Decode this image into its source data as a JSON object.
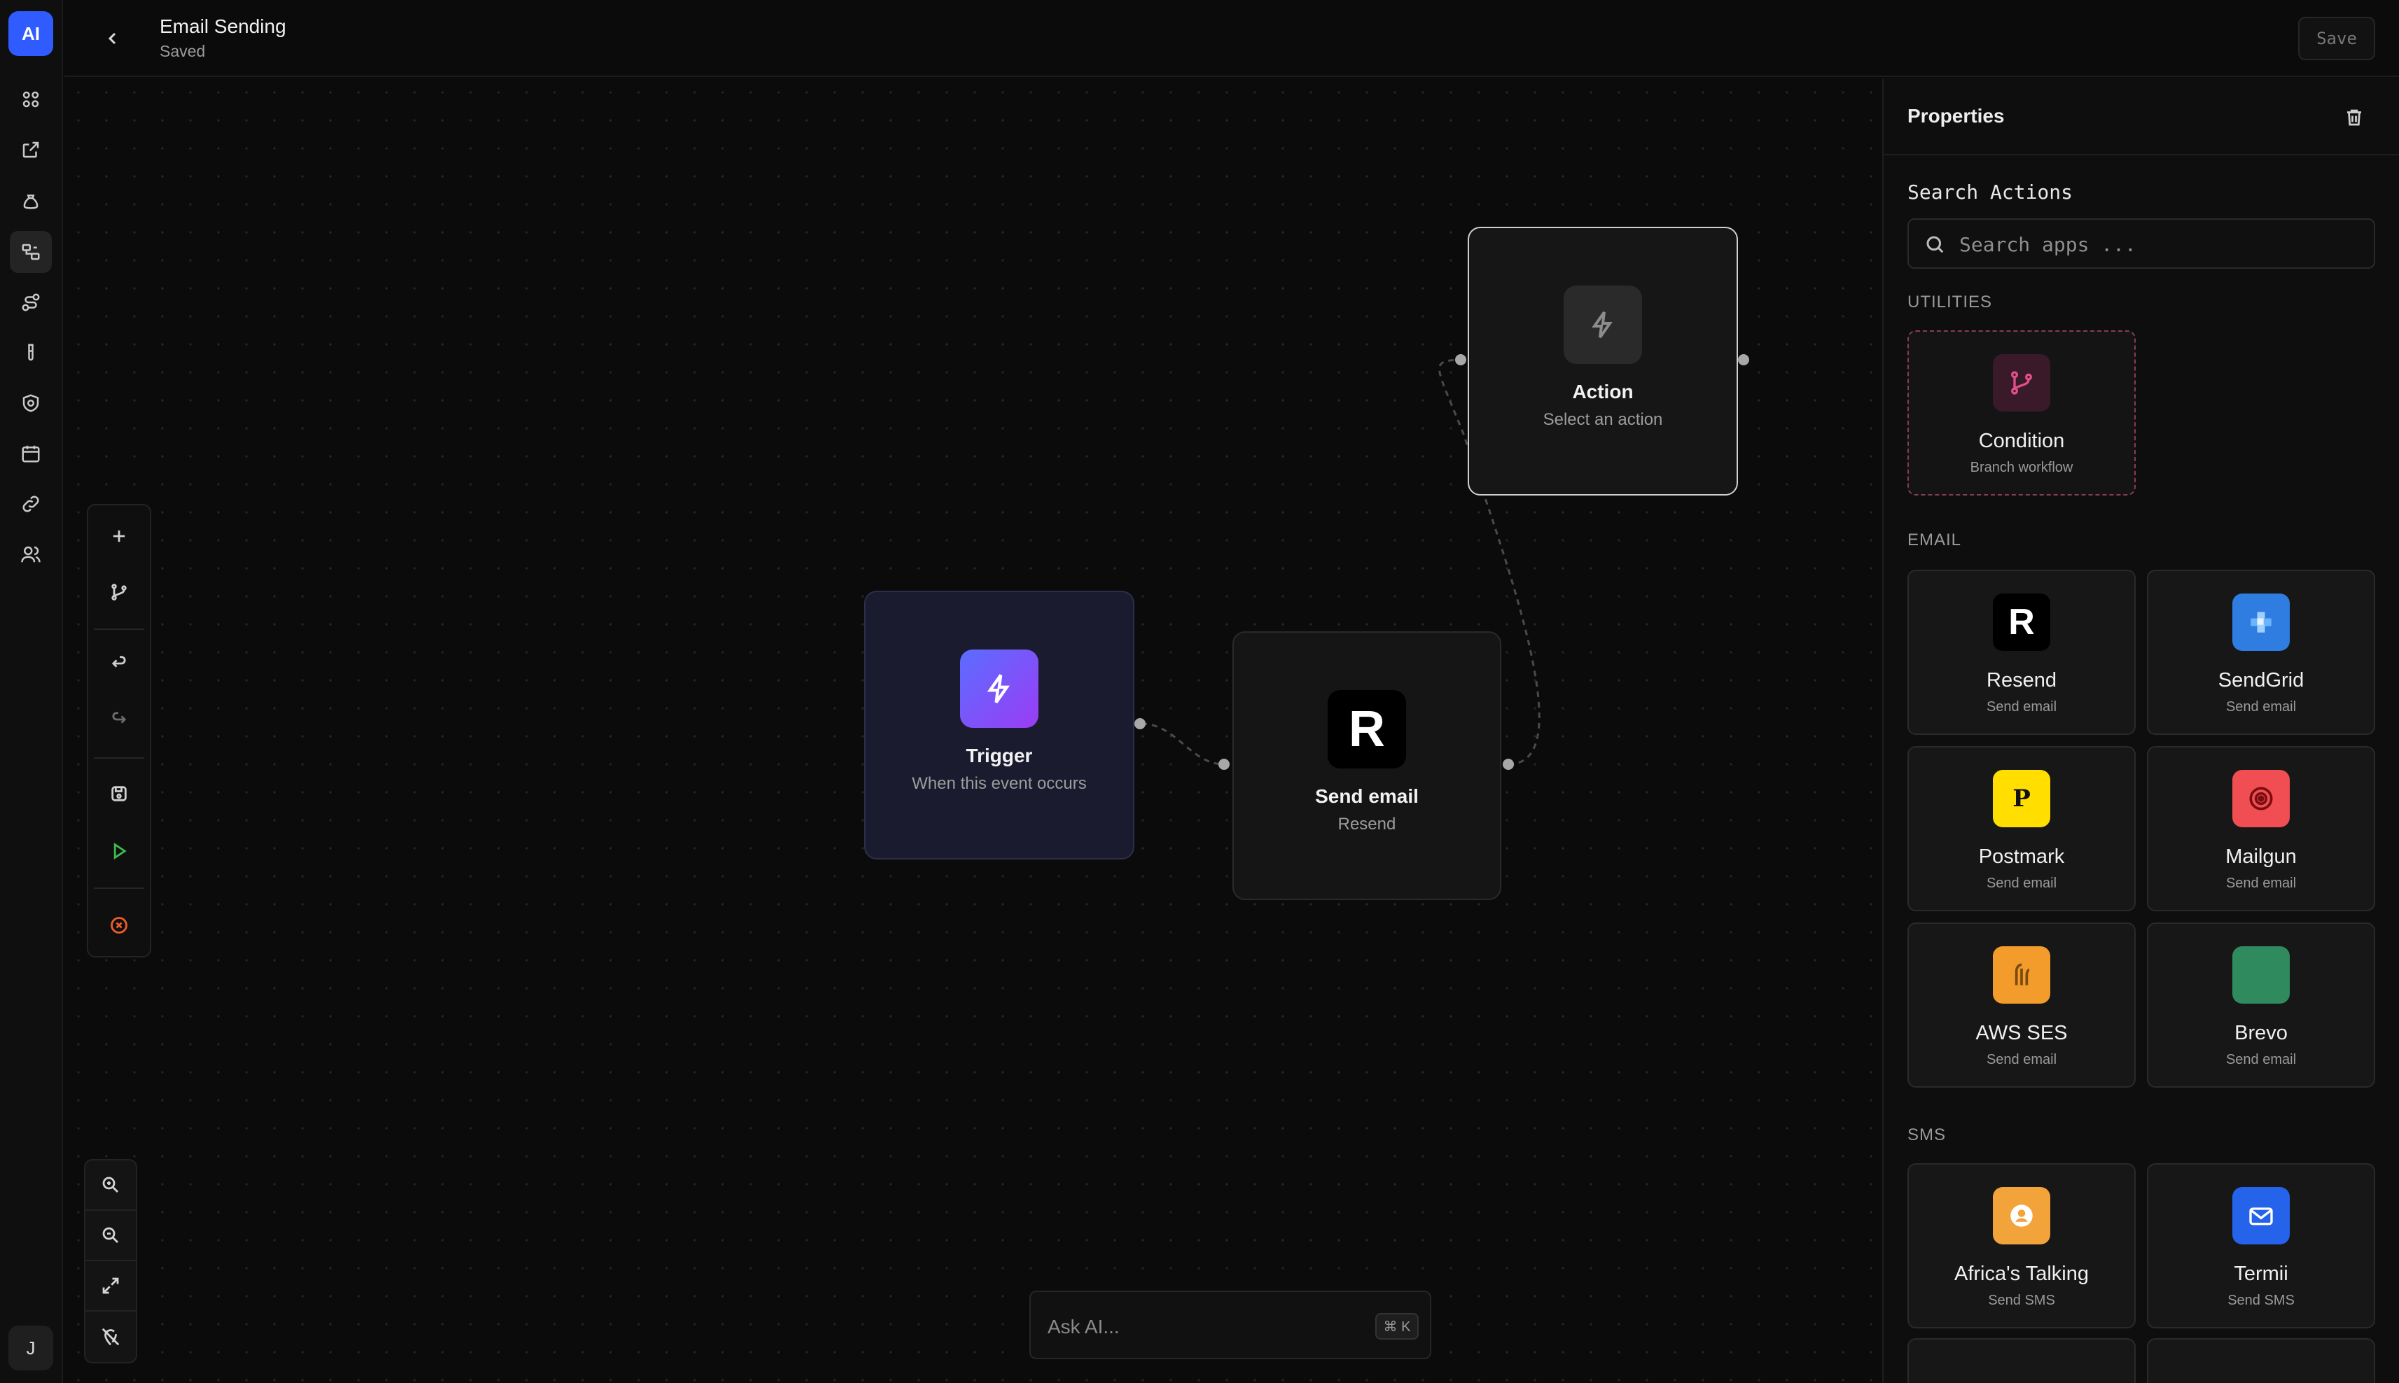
{
  "app": {
    "logo": "AI",
    "user_initial": "J"
  },
  "header": {
    "title": "Email Sending",
    "status": "Saved",
    "save_label": "Save"
  },
  "rail_icons": [
    "grid-icon",
    "external-link-icon",
    "bag-icon",
    "workflow-icon",
    "integrations-icon",
    "flask-icon",
    "shield-icon",
    "calendar-icon",
    "link-icon",
    "users-icon"
  ],
  "canvas": {
    "nodes": {
      "trigger": {
        "title": "Trigger",
        "subtitle": "When this event occurs",
        "icon": "lightning-icon",
        "color": "#7c4dff"
      },
      "send_email": {
        "title": "Send email",
        "subtitle": "Resend",
        "icon_letter": "R"
      },
      "action": {
        "title": "Action",
        "subtitle": "Select an action",
        "icon": "lightning-icon"
      }
    },
    "ask_ai": {
      "placeholder": "Ask AI...",
      "shortcut": "⌘ K"
    }
  },
  "properties": {
    "title": "Properties",
    "search_label": "Search Actions",
    "search_placeholder": "Search apps ...",
    "sections": {
      "utilities": "UTILITIES",
      "email": "EMAIL",
      "sms": "SMS"
    },
    "utilities": [
      {
        "title": "Condition",
        "subtitle": "Branch workflow",
        "icon": "branch-icon"
      }
    ],
    "email": [
      {
        "title": "Resend",
        "subtitle": "Send email",
        "letter": "R",
        "bg": "#000000",
        "fg": "#ffffff"
      },
      {
        "title": "SendGrid",
        "subtitle": "Send email",
        "bg": "#2f7de1"
      },
      {
        "title": "Postmark",
        "subtitle": "Send email",
        "letter": "P",
        "bg": "#ffde00",
        "fg": "#111111"
      },
      {
        "title": "Mailgun",
        "subtitle": "Send email",
        "bg": "#f04e52"
      },
      {
        "title": "AWS SES",
        "subtitle": "Send email",
        "bg": "#f39c2c"
      },
      {
        "title": "Brevo",
        "subtitle": "Send email",
        "bg": "#2f8a5e"
      }
    ],
    "sms": [
      {
        "title": "Africa's Talking",
        "subtitle": "Send SMS",
        "bg": "#f2a33a"
      },
      {
        "title": "Termii",
        "subtitle": "Send SMS",
        "bg": "#2563eb"
      }
    ]
  }
}
